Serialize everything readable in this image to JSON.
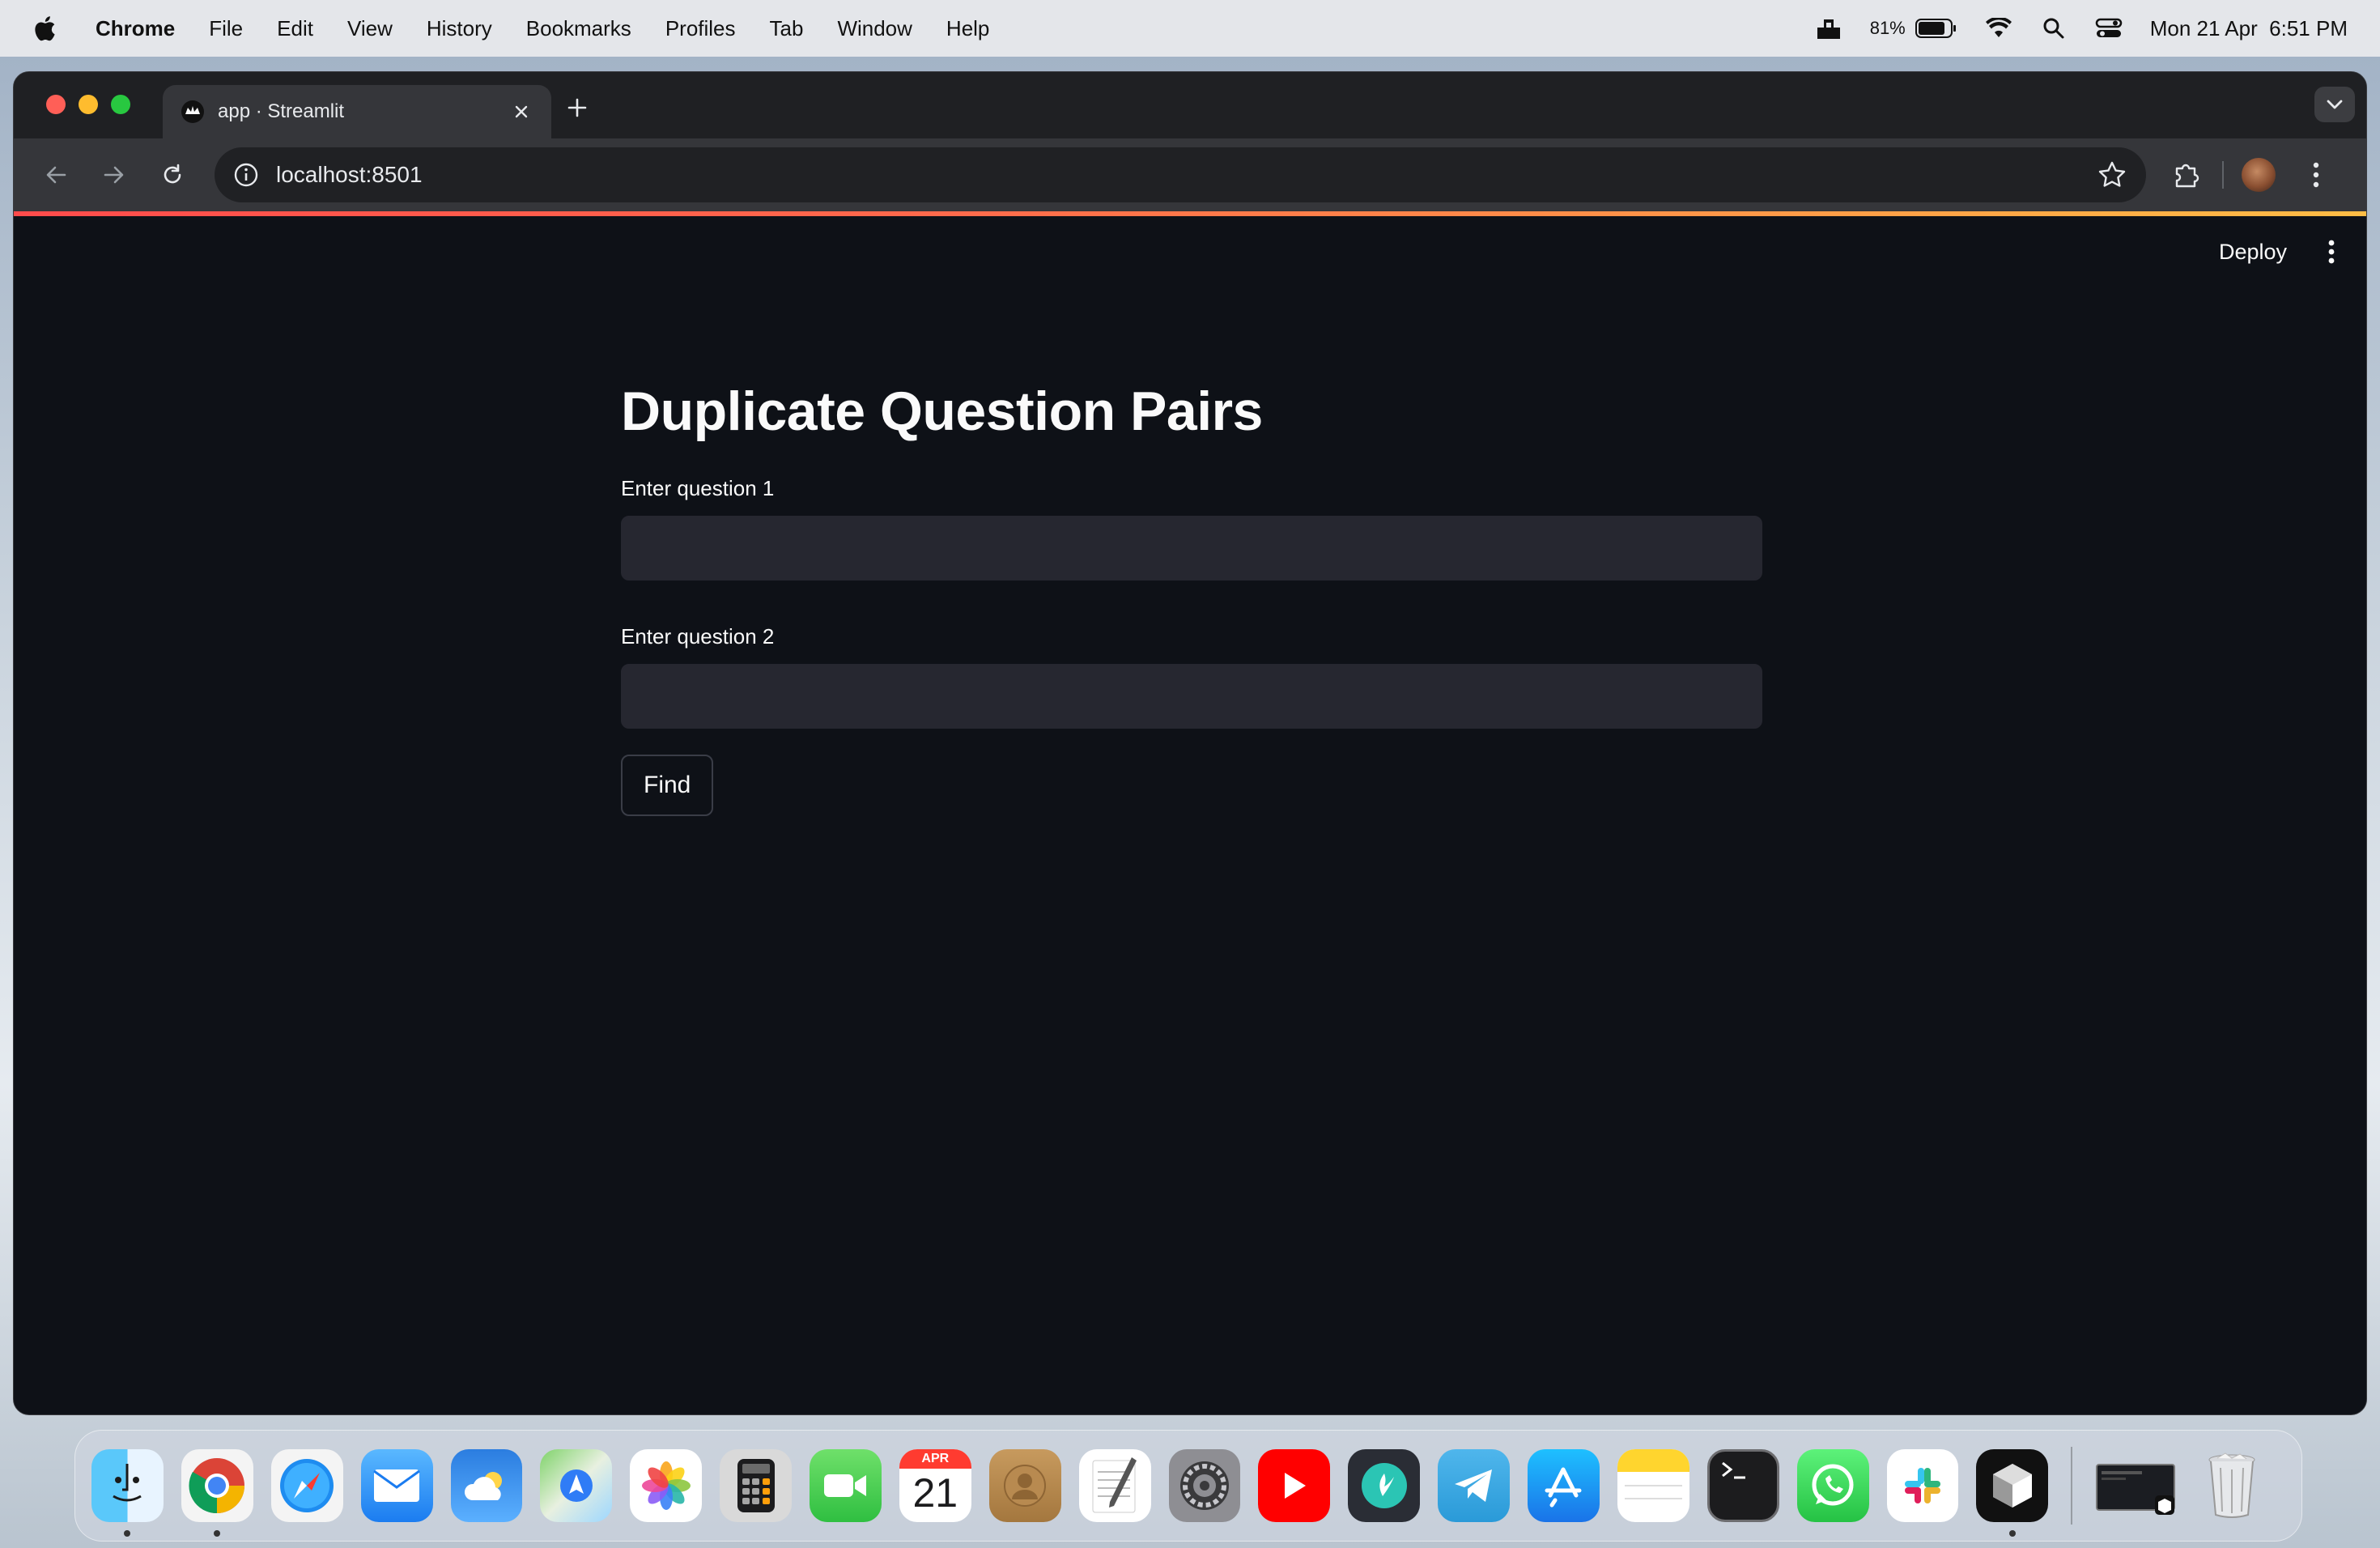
{
  "menubar": {
    "app_name": "Chrome",
    "items": [
      "File",
      "Edit",
      "View",
      "History",
      "Bookmarks",
      "Profiles",
      "Tab",
      "Window",
      "Help"
    ],
    "battery": "81%",
    "datetime": "Mon 21 Apr  6:51 PM"
  },
  "browser": {
    "tab_title": "app · Streamlit",
    "url": "localhost:8501"
  },
  "streamlit": {
    "deploy_label": "Deploy",
    "title": "Duplicate Question Pairs",
    "q1_label": "Enter question 1",
    "q1_value": "",
    "q2_label": "Enter question 2",
    "q2_value": "",
    "button_label": "Find"
  },
  "dock": {
    "calendar_month": "APR",
    "calendar_day": "21",
    "apps": [
      "finder",
      "chrome",
      "safari",
      "mail",
      "weather",
      "maps",
      "photos",
      "calculator",
      "facetime",
      "calendar",
      "contacts",
      "textedit",
      "system-settings",
      "youtube",
      "jiosaavn",
      "telegram",
      "app-store",
      "notes",
      "terminal",
      "whatsapp",
      "slack",
      "cube-app",
      "screenshot-preview",
      "trash"
    ]
  },
  "colors": {
    "page_bg": "#0e1117",
    "input_bg": "#262730",
    "accent_red": "#ff4b4b",
    "accent_yellow": "#ffbd45"
  }
}
